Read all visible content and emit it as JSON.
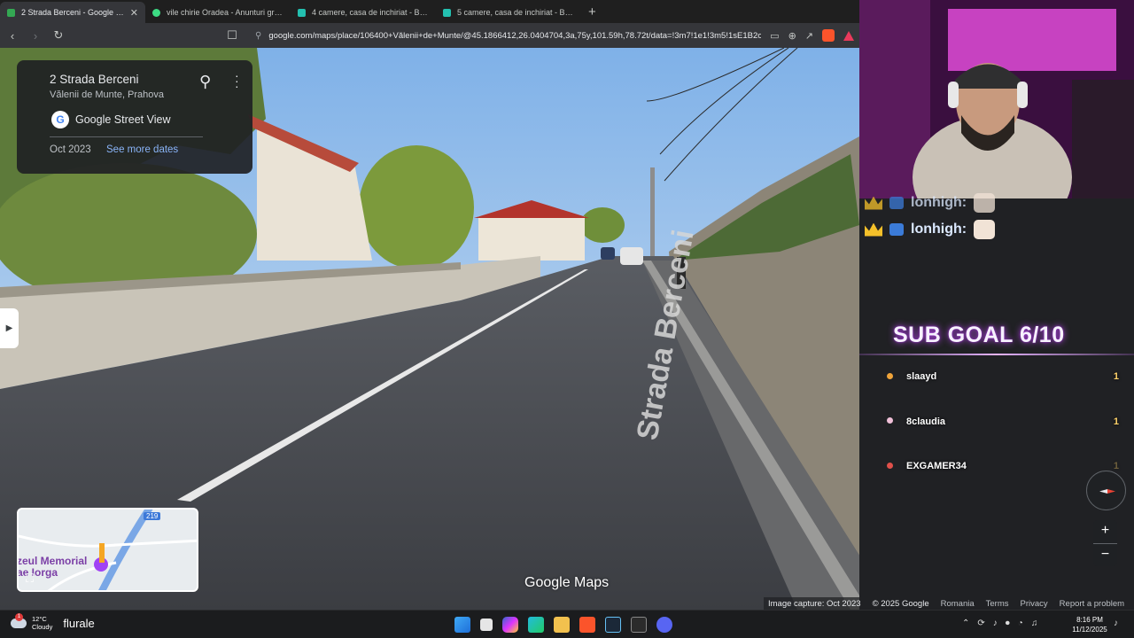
{
  "browser": {
    "tabs": [
      {
        "title": "2 Strada Berceni - Google Maps",
        "active": true,
        "close": "✕",
        "favicon_color": "#34a853"
      },
      {
        "title": "vile chirie Oradea - Anunturi gratuite",
        "active": false,
        "favicon_color": "#3ddc84"
      },
      {
        "title": "4 camere, casa de inchiriat - Bihor (ju",
        "active": false,
        "favicon_color": "#23c0b0"
      },
      {
        "title": "5 camere, casa de inchiriat - Bihor (ju",
        "active": false,
        "favicon_color": "#23c0b0"
      }
    ],
    "new_tab": "+",
    "url": "google.com/maps/place/106400+Vălenii+de+Munte/@45.1866412,26.0404704,3a,75y,101.59h,78.72t/data=!3m7!1e1!3m5!1sE1B2oUEz1r..."
  },
  "place_card": {
    "address": "2 Strada Berceni",
    "locality": "Vălenii de Munte, Prahova",
    "service": "Google Street View",
    "date": "Oct 2023",
    "see_more": "See more dates"
  },
  "street_sign_text": "Strada Berceni",
  "minimap": {
    "place_name": "zeul Memorial\nae Iorga",
    "road_number": "219"
  },
  "brand": "Google Maps",
  "footer": {
    "capture": "Image capture: Oct 2023",
    "copyright": "© 2025 Google",
    "country": "Romania",
    "terms": "Terms",
    "privacy": "Privacy",
    "report": "Report a problem"
  },
  "stream": {
    "chat": [
      {
        "user": "lonhigh:"
      },
      {
        "user": "lonhigh:"
      }
    ],
    "sub_goal": "SUB GOAL 6/10",
    "subs": [
      {
        "name": "slaayd",
        "count": "1",
        "color": "#f0a43a"
      },
      {
        "name": "8claudia",
        "count": "1",
        "color": "#f0c0d8"
      },
      {
        "name": "EXGAMER34",
        "count": "1",
        "color": "#e0504a"
      }
    ]
  },
  "controls": {
    "zoom_in": "+",
    "zoom_out": "−"
  },
  "taskbar": {
    "temp": "12°C",
    "condition": "Cloudy",
    "news": "flurale",
    "time": "8:16 PM",
    "date": "11/12/2025"
  }
}
